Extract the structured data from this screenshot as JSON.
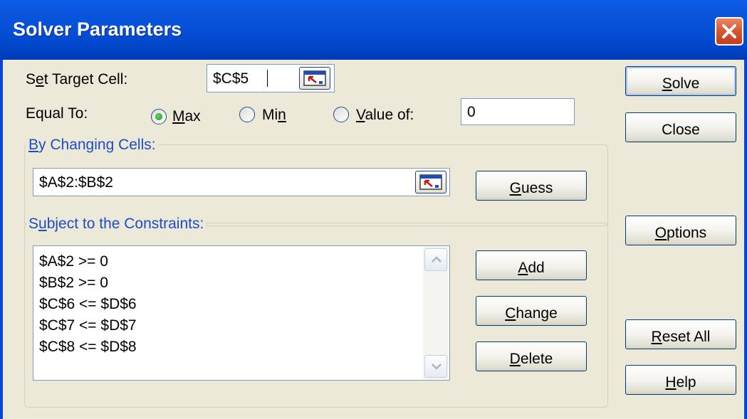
{
  "window": {
    "title": "Solver Parameters"
  },
  "target": {
    "label_pre": "S",
    "label_key": "e",
    "label_post": "t Target Cell:",
    "value": "$C$5"
  },
  "equal_to": {
    "label": "Equal To:",
    "max_key": "M",
    "max_rest": "ax",
    "min_pre": "Mi",
    "min_key": "n",
    "value_key": "V",
    "value_rest": "alue of:",
    "selected": "Max",
    "value": "0"
  },
  "changing": {
    "label_key": "B",
    "label_rest": "y Changing Cells:",
    "value": "$A$2:$B$2"
  },
  "constraints": {
    "label_pre": "S",
    "label_key": "u",
    "label_rest": "bject to the Constraints:",
    "items": [
      "$A$2 >= 0",
      "$B$2 >= 0",
      "$C$6 <= $D$6",
      "$C$7 <= $D$7",
      "$C$8 <= $D$8"
    ]
  },
  "buttons": {
    "solve_key": "S",
    "solve_rest": "olve",
    "close": "Close",
    "guess_key": "G",
    "guess_rest": "uess",
    "options_key": "O",
    "options_rest": "ptions",
    "add_key": "A",
    "add_rest": "dd",
    "change_key": "C",
    "change_rest": "hange",
    "delete_key": "D",
    "delete_rest": "elete",
    "reset_key": "R",
    "reset_rest": "eset All",
    "help_key": "H",
    "help_rest": "elp"
  },
  "colors": {
    "titlebar": "#0650D8",
    "group_label": "#1D4CC8",
    "dialog_bg": "#ECE9D8"
  }
}
